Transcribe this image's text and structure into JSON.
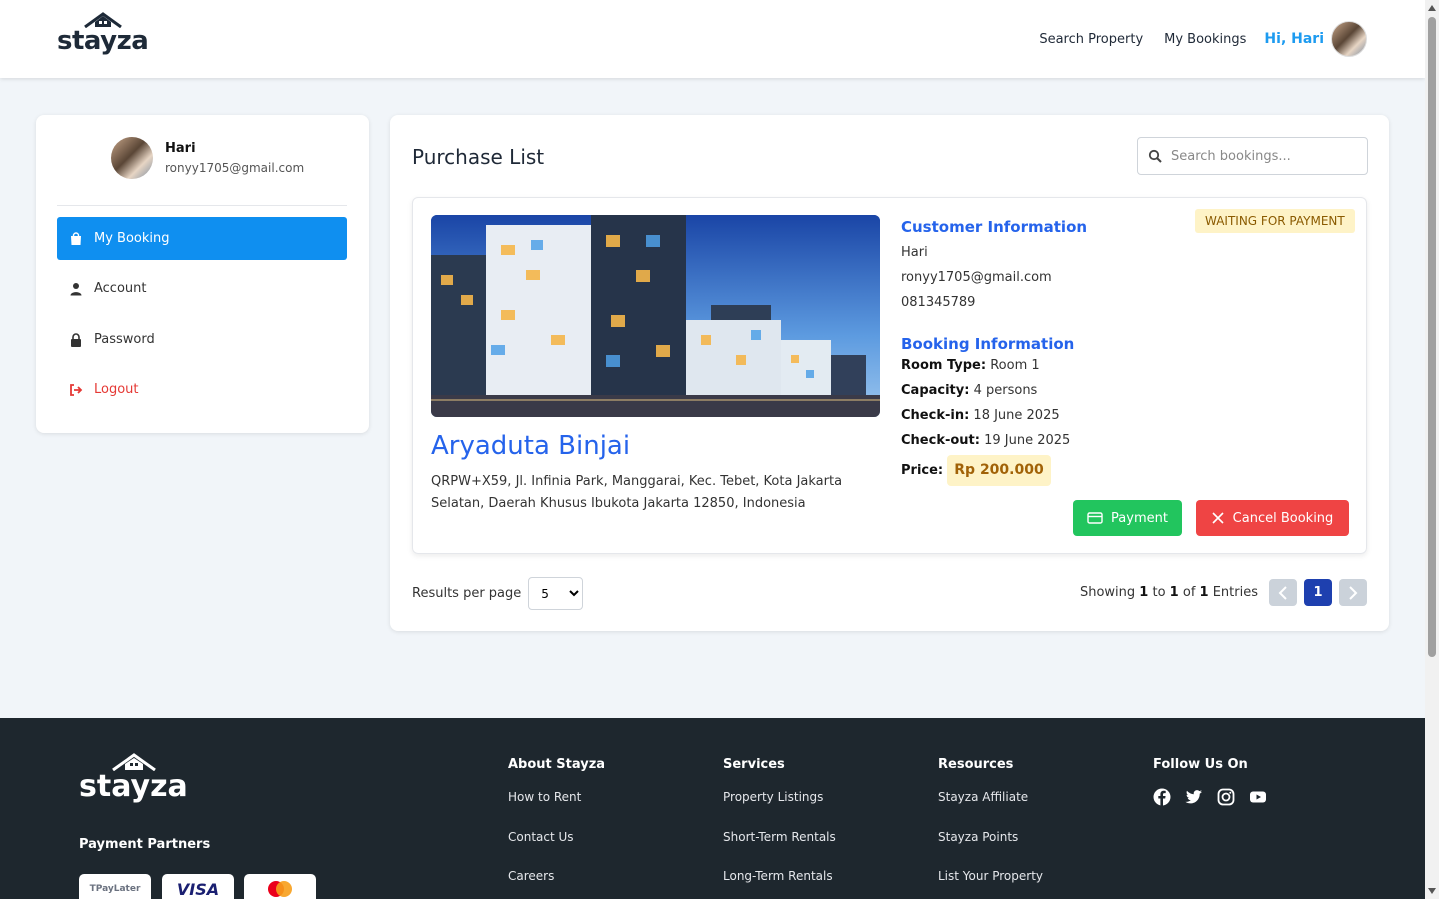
{
  "header": {
    "logo_text": "stayza",
    "nav": {
      "search_property": "Search Property",
      "my_bookings": "My Bookings",
      "greeting": "Hi, Hari"
    }
  },
  "sidebar": {
    "user_name": "Hari",
    "user_email": "ronyy1705@gmail.com",
    "items": [
      {
        "label": "My Booking",
        "icon": "shopping-bag-icon",
        "active": true
      },
      {
        "label": "Account",
        "icon": "user-icon",
        "active": false
      },
      {
        "label": "Password",
        "icon": "lock-icon",
        "active": false
      },
      {
        "label": "Logout",
        "icon": "logout-icon",
        "active": false
      }
    ]
  },
  "main": {
    "title": "Purchase List",
    "search_placeholder": "Search bookings...",
    "booking": {
      "status": "WAITING FOR PAYMENT",
      "property_name": "Aryaduta Binjai",
      "address": "QRPW+X59, Jl. Infinia Park, Manggarai, Kec. Tebet, Kota Jakarta Selatan, Daerah Khusus Ibukota Jakarta 12850, Indonesia",
      "customer_heading": "Customer Information",
      "customer_name": "Hari",
      "customer_email": "ronyy1705@gmail.com",
      "customer_phone": "081345789",
      "booking_heading": "Booking Information",
      "room_type_label": "Room Type:",
      "room_type": "Room 1",
      "capacity_label": "Capacity:",
      "capacity": "4 persons",
      "checkin_label": "Check-in:",
      "checkin": "18 June 2025",
      "checkout_label": "Check-out:",
      "checkout": "19 June 2025",
      "price_label": "Price:",
      "price": "Rp 200.000",
      "payment_button": "Payment",
      "cancel_button": "Cancel Booking"
    },
    "pagination": {
      "per_page_label": "Results per page",
      "per_page_value": "5",
      "showing_prefix": "Showing",
      "from": "1",
      "to_word": "to",
      "to": "1",
      "of_word": "of",
      "total": "1",
      "entries_word": "Entries",
      "current_page": "1"
    }
  },
  "footer": {
    "logo_text": "stayza",
    "payment_partners_title": "Payment Partners",
    "payment_partners": [
      "TPayLater",
      "VISA",
      "Mastercard"
    ],
    "about": {
      "title": "About Stayza",
      "links": [
        "How to Rent",
        "Contact Us",
        "Careers"
      ]
    },
    "services": {
      "title": "Services",
      "links": [
        "Property Listings",
        "Short-Term Rentals",
        "Long-Term Rentals"
      ]
    },
    "resources": {
      "title": "Resources",
      "links": [
        "Stayza Affiliate",
        "Stayza Points",
        "List Your Property"
      ]
    },
    "follow": {
      "title": "Follow Us On",
      "icons": [
        "facebook-icon",
        "twitter-icon",
        "instagram-icon",
        "youtube-icon"
      ]
    }
  },
  "colors": {
    "primary": "#0f8ff0",
    "link_blue": "#2563eb",
    "success": "#22c55e",
    "danger": "#ef4444",
    "footer_bg": "#1e272e",
    "status_bg": "#fef3c7"
  }
}
